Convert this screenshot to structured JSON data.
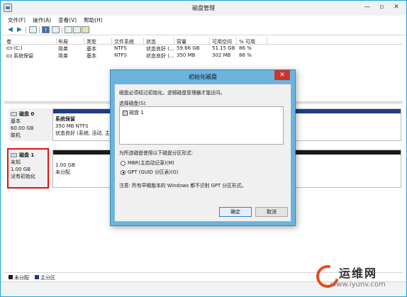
{
  "window": {
    "title": "磁盘管理",
    "controls": [
      "—",
      "▫",
      "✕"
    ]
  },
  "menu": [
    "文件(F)",
    "操作(A)",
    "查看(V)",
    "帮助(H)"
  ],
  "volume_table": {
    "headers": [
      "卷",
      "布局",
      "类型",
      "文件系统",
      "状态",
      "容量",
      "可用空间",
      "% 可用"
    ],
    "rows": [
      [
        "(C:)",
        "简单",
        "基本",
        "NTFS",
        "状态良好 (...",
        "59.66 GB",
        "51.15 GB",
        "86 %"
      ],
      [
        "系统保留",
        "简单",
        "基本",
        "NTFS",
        "状态良好 (...",
        "350 MB",
        "302 MB",
        "86 %"
      ]
    ]
  },
  "disks": [
    {
      "name": "磁盘 0",
      "lines": [
        "基本",
        "60.00 GB",
        "联机"
      ],
      "partition": {
        "title": "系统保留",
        "size": "350 MB NTFS",
        "status": "状态良好 (系统, 活动, 主分"
      }
    },
    {
      "name": "磁盘 1",
      "lines": [
        "未知",
        "1.00 GB",
        "没有初始化"
      ],
      "partition": {
        "size": "1.00 GB",
        "status": "未分配"
      }
    }
  ],
  "legend": [
    {
      "label": "未分配",
      "color": "#1a1a1a"
    },
    {
      "label": "主分区",
      "color": "#1f3a8c"
    }
  ],
  "dialog": {
    "title": "初始化磁盘",
    "close": "✕",
    "message": "磁盘必须经过初始化，逻辑磁盘管理器才能访问。",
    "select_label": "选择磁盘(S):",
    "disk_item": "磁盘 1",
    "style_label": "为所选磁盘使用以下磁盘分区形式:",
    "options": [
      "MBR(主启动记录)(M)",
      "GPT (GUID 分区表)(G)"
    ],
    "selected_option": "GPT (GUID 分区表)(G)",
    "note": "注意: 所有早期版本的 Windows 都不识别 GPT 分区形式。",
    "ok_label": "确定",
    "cancel_label": "取消"
  },
  "watermark": {
    "top": "运维网",
    "bottom": "www.iyunv.com"
  },
  "colors": {
    "primary_partition": "#1f3a8c",
    "unallocated": "#1a1a1a",
    "highlight": "#e01212",
    "dialog_frame": "#6ab4de"
  }
}
